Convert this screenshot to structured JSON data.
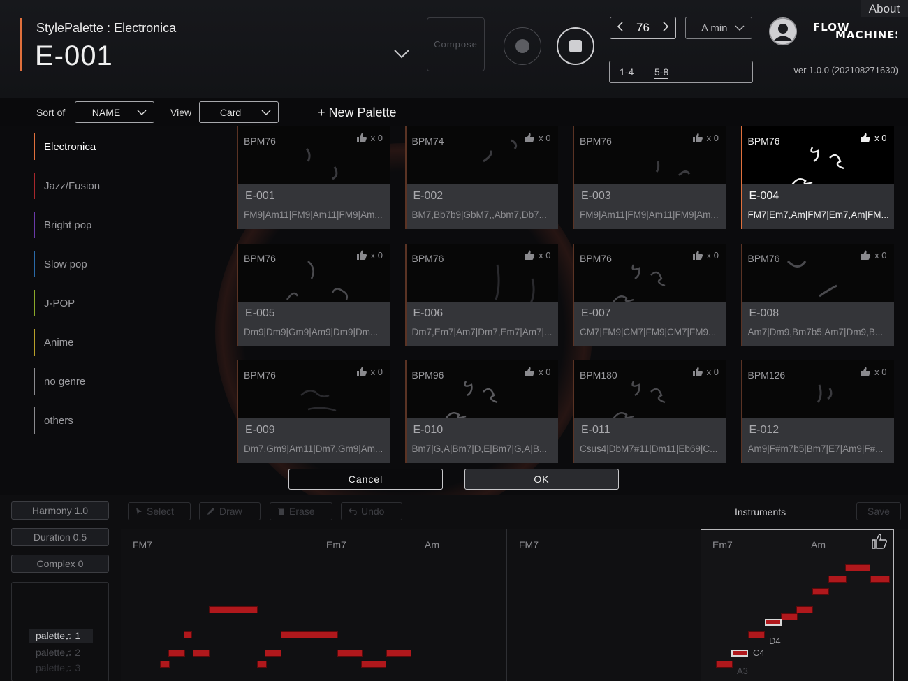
{
  "header": {
    "style_title": "StylePalette : Electronica",
    "palette_name": "E-001",
    "compose_label": "Compose",
    "tempo": "76",
    "key": "A min",
    "bars_a": "1-4",
    "bars_b": "5-8",
    "logo": "FLOW MACHINES",
    "about_label": "About",
    "version": "ver 1.0.0 (202108271630)",
    "accent_color": "#e0703c"
  },
  "toolbar": {
    "sort_label": "Sort of",
    "sort_value": "NAME",
    "view_label": "View",
    "view_value": "Card",
    "new_palette_label": "+ New Palette"
  },
  "genres": [
    {
      "label": "Electronica",
      "color": "#e0703c"
    },
    {
      "label": "Jazz/Fusion",
      "color": "#a8282c"
    },
    {
      "label": "Bright pop",
      "color": "#6a3aa8"
    },
    {
      "label": "Slow pop",
      "color": "#2a6aa8"
    },
    {
      "label": "J-POP",
      "color": "#8aa82a"
    },
    {
      "label": "Anime",
      "color": "#b8a02a"
    },
    {
      "label": "no genre",
      "color": "#8a8a8e"
    },
    {
      "label": "others",
      "color": "#8a8a8e"
    }
  ],
  "cards": [
    {
      "bpm": "BPM76",
      "likes": "x 0",
      "name": "E-001",
      "chords": "FM9|Am11|FM9|Am11|FM9|Am..."
    },
    {
      "bpm": "BPM74",
      "likes": "x 0",
      "name": "E-002",
      "chords": "BM7,Bb7b9|GbM7,,Abm7,Db7..."
    },
    {
      "bpm": "BPM76",
      "likes": "x 0",
      "name": "E-003",
      "chords": "FM9|Am11|FM9|Am11|FM9|Am..."
    },
    {
      "bpm": "BPM76",
      "likes": "x 0",
      "name": "E-004",
      "chords": "FM7|Em7,Am|FM7|Em7,Am|FM..."
    },
    {
      "bpm": "BPM76",
      "likes": "x 0",
      "name": "E-005",
      "chords": "Dm9|Dm9|Gm9|Am9|Dm9|Dm..."
    },
    {
      "bpm": "BPM76",
      "likes": "x 0",
      "name": "E-006",
      "chords": "Dm7,Em7|Am7|Dm7,Em7|Am7|..."
    },
    {
      "bpm": "BPM76",
      "likes": "x 0",
      "name": "E-007",
      "chords": "CM7|FM9|CM7|FM9|CM7|FM9..."
    },
    {
      "bpm": "BPM76",
      "likes": "x 0",
      "name": "E-008",
      "chords": "Am7|Dm9,Bm7b5|Am7|Dm9,B..."
    },
    {
      "bpm": "BPM76",
      "likes": "x 0",
      "name": "E-009",
      "chords": "Dm7,Gm9|Am11|Dm7,Gm9|Am..."
    },
    {
      "bpm": "BPM96",
      "likes": "x 0",
      "name": "E-010",
      "chords": "Bm7|G,A|Bm7|D,E|Bm7|G,A|B..."
    },
    {
      "bpm": "BPM180",
      "likes": "x 0",
      "name": "E-011",
      "chords": "Csus4|DbM7#11|Dm11|Eb69|C..."
    },
    {
      "bpm": "BPM126",
      "likes": "x 0",
      "name": "E-012",
      "chords": "Am9|F#m7b5|Bm7|E7|Am9|F#..."
    }
  ],
  "dialog": {
    "cancel_label": "Cancel",
    "ok_label": "OK"
  },
  "editor": {
    "params": [
      "Harmony 1.0",
      "Duration 0.5",
      "Complex 0"
    ],
    "palettes": [
      "palette♫ 1",
      "palette♫ 2",
      "palette♫ 3"
    ],
    "tools": [
      "Select",
      "Draw",
      "Erase",
      "Undo"
    ],
    "instruments_label": "Instruments",
    "save_label": "Save",
    "roll_chords": [
      "FM7",
      "Em7",
      "Am",
      "FM7",
      "Em7",
      "Am"
    ],
    "pitch_labels": [
      "D4",
      "C4",
      "A3"
    ],
    "note_color": "#b0181c"
  }
}
